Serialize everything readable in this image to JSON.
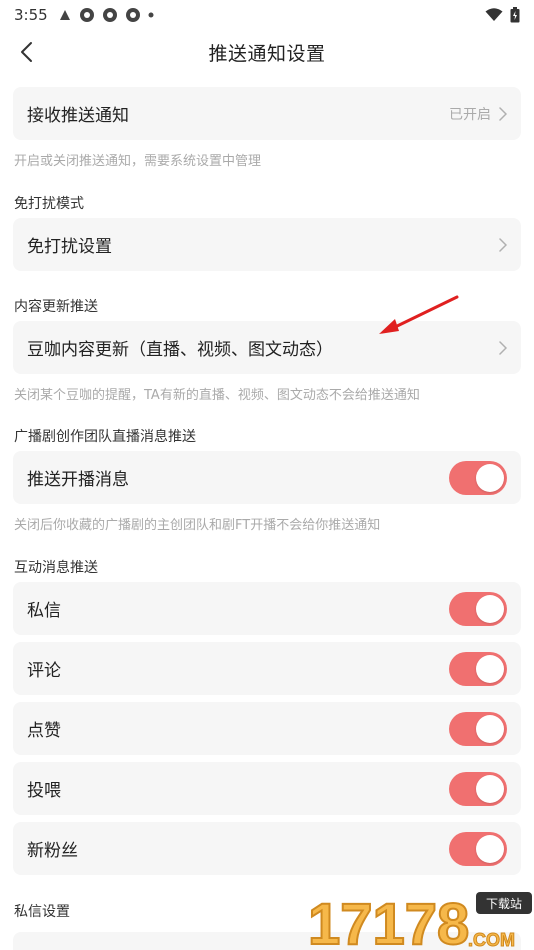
{
  "status_bar": {
    "time": "3:55",
    "icons": [
      "notification-icon",
      "app-icon",
      "app-icon",
      "app-icon",
      "dot-icon"
    ],
    "right_icons": [
      "wifi-icon",
      "battery-icon"
    ]
  },
  "header": {
    "title": "推送通知设置"
  },
  "receive": {
    "label": "接收推送通知",
    "value": "已开启",
    "hint": "开启或关闭推送通知，需要系统设置中管理"
  },
  "dnd": {
    "section_title": "免打扰模式",
    "label": "免打扰设置"
  },
  "content_update": {
    "section_title": "内容更新推送",
    "label": "豆咖内容更新（直播、视频、图文动态）",
    "hint": "关闭某个豆咖的提醒，TA有新的直播、视频、图文动态不会给推送通知"
  },
  "drama": {
    "section_title": "广播剧创作团队直播消息推送",
    "label": "推送开播消息",
    "enabled": true,
    "hint": "关闭后你收藏的广播剧的主创团队和剧FT开播不会给你推送通知"
  },
  "interaction": {
    "section_title": "互动消息推送",
    "items": [
      {
        "label": "私信",
        "enabled": true
      },
      {
        "label": "评论",
        "enabled": true
      },
      {
        "label": "点赞",
        "enabled": true
      },
      {
        "label": "投喂",
        "enabled": true
      },
      {
        "label": "新粉丝",
        "enabled": true
      }
    ]
  },
  "private_msg": {
    "section_title": "私信设置"
  },
  "watermark": {
    "text": "17178",
    "badge": "下载站",
    "suffix": ".COM"
  },
  "colors": {
    "toggle_on": "#f07070",
    "card_bg": "#f6f6f6",
    "annotation_arrow": "#e02020"
  }
}
